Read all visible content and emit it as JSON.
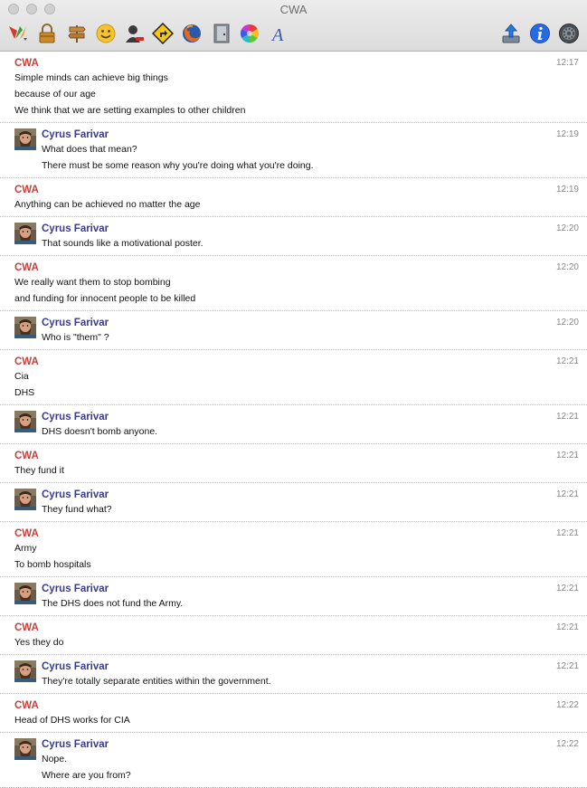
{
  "window": {
    "title": "CWA"
  },
  "toolbar": {
    "icons": [
      "adium-menu-icon",
      "lock-icon",
      "signpost-icon",
      "smiley-icon",
      "contact-block-icon",
      "directions-icon",
      "firefox-icon",
      "door-icon",
      "color-wheel-icon",
      "font-icon",
      "send-file-icon",
      "info-icon",
      "gear-icon"
    ]
  },
  "colors": {
    "cwa_sender": "#c8403b",
    "cyrus_sender": "#3a3b8c"
  },
  "messages": [
    {
      "sender": "CWA",
      "time": "12:17",
      "lines": [
        "Simple minds can achieve big things",
        "because of our age",
        "We think that we are setting examples to other children"
      ]
    },
    {
      "sender": "Cyrus Farivar",
      "time": "12:19",
      "lines": [
        "What does that mean?",
        "There must be some reason why you're doing what you're doing."
      ]
    },
    {
      "sender": "CWA",
      "time": "12:19",
      "lines": [
        "Anything can be achieved no matter the age"
      ]
    },
    {
      "sender": "Cyrus Farivar",
      "time": "12:20",
      "lines": [
        "That sounds like a motivational poster."
      ]
    },
    {
      "sender": "CWA",
      "time": "12:20",
      "lines": [
        "We really want them to stop bombing",
        "and funding for innocent people to be killed"
      ]
    },
    {
      "sender": "Cyrus Farivar",
      "time": "12:20",
      "lines": [
        "Who is \"them\" ?"
      ]
    },
    {
      "sender": "CWA",
      "time": "12:21",
      "lines": [
        "Cia",
        "DHS"
      ]
    },
    {
      "sender": "Cyrus Farivar",
      "time": "12:21",
      "lines": [
        "DHS doesn't bomb anyone."
      ]
    },
    {
      "sender": "CWA",
      "time": "12:21",
      "lines": [
        "They fund it"
      ]
    },
    {
      "sender": "Cyrus Farivar",
      "time": "12:21",
      "lines": [
        "They fund what?"
      ]
    },
    {
      "sender": "CWA",
      "time": "12:21",
      "lines": [
        "Army",
        "To bomb hospitals"
      ]
    },
    {
      "sender": "Cyrus Farivar",
      "time": "12:21",
      "lines": [
        "The DHS does not fund the Army."
      ]
    },
    {
      "sender": "CWA",
      "time": "12:21",
      "lines": [
        "Yes they do"
      ]
    },
    {
      "sender": "Cyrus Farivar",
      "time": "12:21",
      "lines": [
        "They're totally separate entities within the government."
      ]
    },
    {
      "sender": "CWA",
      "time": "12:22",
      "lines": [
        "Head of DHS works for CIA"
      ]
    },
    {
      "sender": "Cyrus Farivar",
      "time": "12:22",
      "lines": [
        "Nope.",
        "Where are you from?"
      ]
    }
  ]
}
